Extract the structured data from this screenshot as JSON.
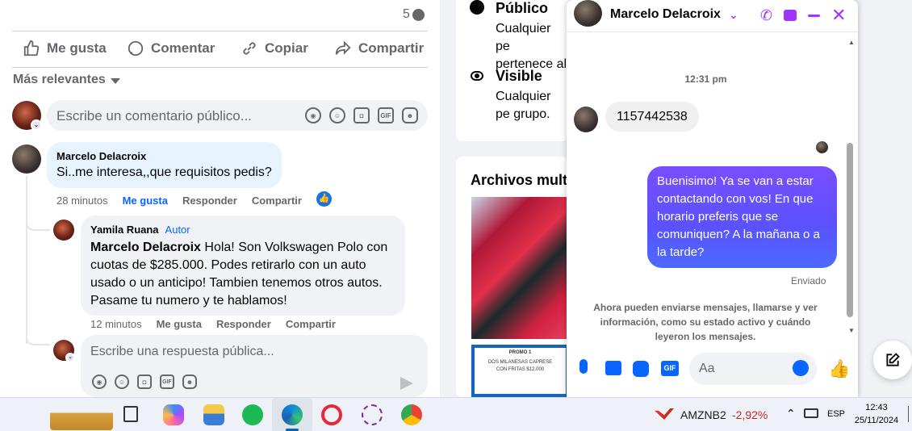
{
  "post": {
    "comment_count": "5",
    "actions": {
      "like": "Me gusta",
      "comment": "Comentar",
      "copy": "Copiar",
      "share": "Compartir"
    },
    "sort_label": "Más relevantes",
    "comment_placeholder": "Escribe un comentario público...",
    "comments": [
      {
        "author": "Marcelo Delacroix",
        "text": "Si..me interesa,,que requisitos pedis?",
        "time": "28 minutos",
        "like": "Me gusta",
        "reply": "Responder",
        "share": "Compartir"
      }
    ],
    "reply": {
      "author": "Yamila Ruana",
      "badge": "Autor",
      "mention": "Marcelo Delacroix",
      "text": " Hola! Son Volkswagen Polo con cuotas de $285.000. Podes retirarlo con un auto usado o un anticipo! Tambien tenemos otros autos. Pasame tu numero y te hablamos!",
      "time": "12 minutos",
      "like": "Me gusta",
      "reply": "Responder",
      "share": "Compartir"
    },
    "reply_placeholder": "Escribe una respuesta pública..."
  },
  "middle": {
    "public_title": "Público",
    "public_desc": "Cualquier pe pertenece al",
    "visible_title": "Visible",
    "visible_desc": "Cualquier pe grupo.",
    "media_title": "Archivos multi",
    "promo_title": "PROMO 1",
    "promo_text": "DOS MILANESAS CAPRESE CON FRITAS $12.000"
  },
  "chat": {
    "contact_name": "Marcelo Delacroix",
    "time_divider": "12:31 pm",
    "incoming": "1157442538",
    "outgoing": "Buenisimo! Ya se van a estar contactando con vos! En que horario preferis que se comuniquen? A la mañana o a la tarde?",
    "status": "Enviado",
    "notice": "Ahora pueden enviarse mensajes, llamarse y ver información, como su estado activo y cuándo leyeron los mensajes.",
    "input_placeholder": "Aa",
    "accent": "#a033ff"
  },
  "taskbar": {
    "stock_symbol": "AMZNB2",
    "stock_change": "-2,92%",
    "language": "ESP",
    "time": "12:43",
    "date": "25/11/2024"
  }
}
